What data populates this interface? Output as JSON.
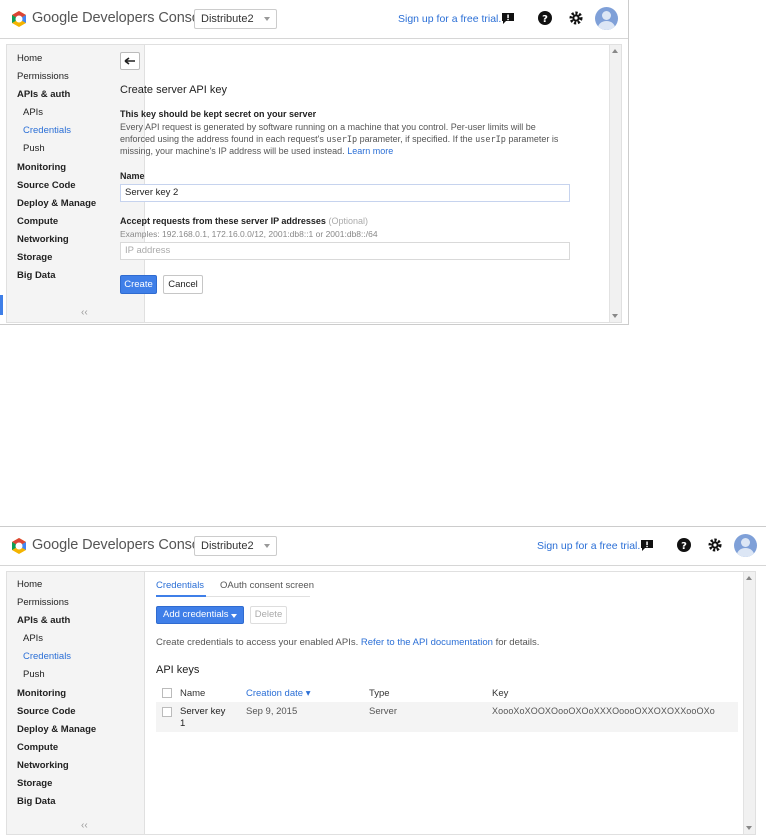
{
  "brand": {
    "name": "Google Developers Console"
  },
  "project": {
    "name": "Distribute2"
  },
  "header": {
    "signup_label": "Sign up for a free trial."
  },
  "sidebar": {
    "items": [
      {
        "label": "Home"
      },
      {
        "label": "Permissions"
      },
      {
        "label": "APIs & auth"
      },
      {
        "label": "APIs"
      },
      {
        "label": "Credentials"
      },
      {
        "label": "Push"
      },
      {
        "label": "Monitoring"
      },
      {
        "label": "Source Code"
      },
      {
        "label": "Deploy & Manage"
      },
      {
        "label": "Compute"
      },
      {
        "label": "Networking"
      },
      {
        "label": "Storage"
      },
      {
        "label": "Big Data"
      }
    ],
    "collapse_label": "‹‹"
  },
  "screen1": {
    "title": "Create server API key",
    "warning_heading": "This key should be kept secret on your server",
    "desc_line1": "Every API request is generated by software running on a machine that you control. Per-user limits will be",
    "desc_line2_a": "enforced using the address found in each request's ",
    "desc_line2_code": "userIp",
    "desc_line2_b": " parameter, if specified. If the ",
    "desc_line2_code2": "userIp",
    "desc_line2_c": " parameter is",
    "desc_line3": "missing, your machine's IP address will be used instead.",
    "learn_more": "Learn more",
    "name_label": "Name",
    "name_value": "Server key 2",
    "ip_label": "Accept requests from these server IP addresses",
    "ip_optional": "(Optional)",
    "ip_examples": "Examples: 192.168.0.1, 172.16.0.0/12, 2001:db8::1 or 2001:db8::/64",
    "ip_placeholder": "IP address",
    "create_button": "Create",
    "cancel_button": "Cancel"
  },
  "screen2": {
    "tabs": [
      {
        "label": "Credentials"
      },
      {
        "label": "OAuth consent screen"
      }
    ],
    "add_button": "Add credentials",
    "delete_button": "Delete",
    "intro_a": "Create credentials to access your enabled APIs.",
    "intro_link": "Refer to the API documentation",
    "intro_b": "for details.",
    "section_title": "API keys",
    "columns": [
      "Name",
      "Creation date",
      "Type",
      "Key"
    ],
    "sort_indicator": "▾",
    "rows": [
      {
        "name_line1": "Server key",
        "name_line2": "1",
        "date": "Sep 9, 2015",
        "type": "Server",
        "key": "XoooXoXOOXOooOXOoXXXOoooOXXOXOXXooOXo"
      }
    ]
  },
  "colors": {
    "accent": "#3f7fe8",
    "link": "#2b6fd6"
  }
}
